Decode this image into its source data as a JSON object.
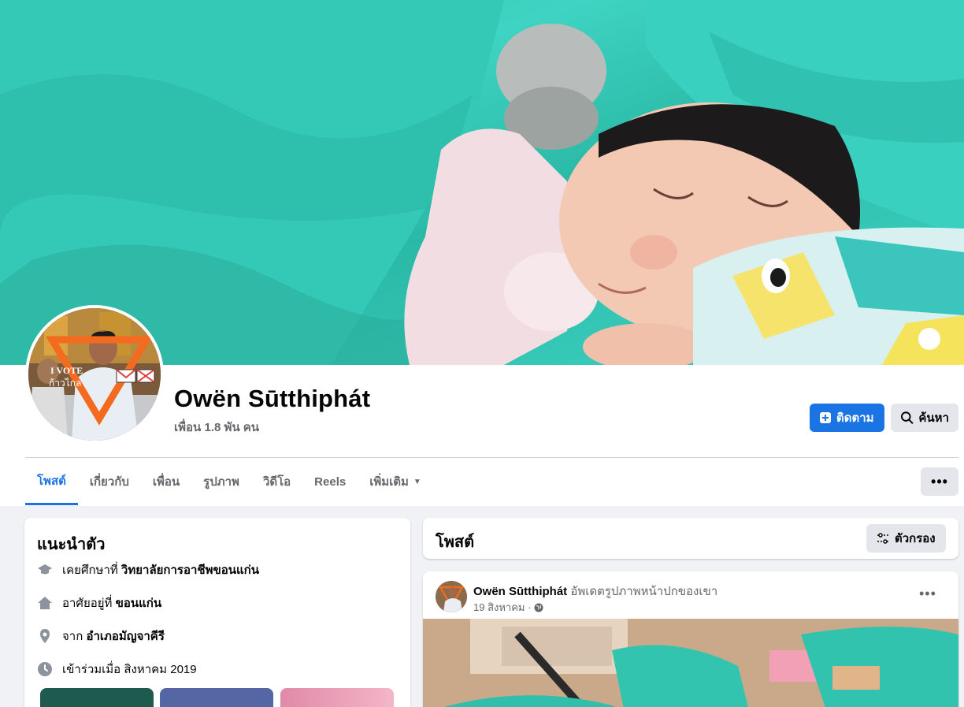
{
  "profile": {
    "name": "Owën Sūtthiphát",
    "friends_text": "เพื่อน 1.8 พัน คน",
    "avatar_frame_text_line1": "I VOTE",
    "avatar_frame_text_line2": "ก้าวไกล"
  },
  "actions": {
    "follow_label": "ติดตาม",
    "search_label": "ค้นหา",
    "more_label": "•••"
  },
  "tabs": [
    {
      "label": "โพสต์",
      "active": true
    },
    {
      "label": "เกี่ยวกับ"
    },
    {
      "label": "เพื่อน"
    },
    {
      "label": "รูปภาพ"
    },
    {
      "label": "วิดีโอ"
    },
    {
      "label": "Reels"
    },
    {
      "label": "เพิ่มเติม"
    }
  ],
  "intro": {
    "title": "แนะนำตัว",
    "rows": [
      {
        "icon": "graduation-cap-icon",
        "prefix": "เคยศึกษาที่ ",
        "value": "วิทยาลัยการอาชีพขอนแก่น"
      },
      {
        "icon": "home-icon",
        "prefix": "อาศัยอยู่ที่ ",
        "value": "ขอนแก่น"
      },
      {
        "icon": "location-pin-icon",
        "prefix": "จาก ",
        "value": "อำเภอมัญจาคีรี"
      },
      {
        "icon": "clock-icon",
        "prefix": "เข้าร่วมเมื่อ สิงหาคม 2019",
        "value": ""
      }
    ]
  },
  "posts_header": {
    "title": "โพสต์",
    "filter_label": "ตัวกรอง"
  },
  "post": {
    "author": "Owën Sūtthiphát",
    "action": "อัพเดตรูปภาพหน้าปกของเขา",
    "time": "19 สิงหาคม ·",
    "more_label": "•••"
  },
  "colors": {
    "accent": "#1b74e4",
    "secondary_text": "#65676b",
    "button_gray": "#e4e6eb",
    "page_bg": "#f0f2f5"
  }
}
